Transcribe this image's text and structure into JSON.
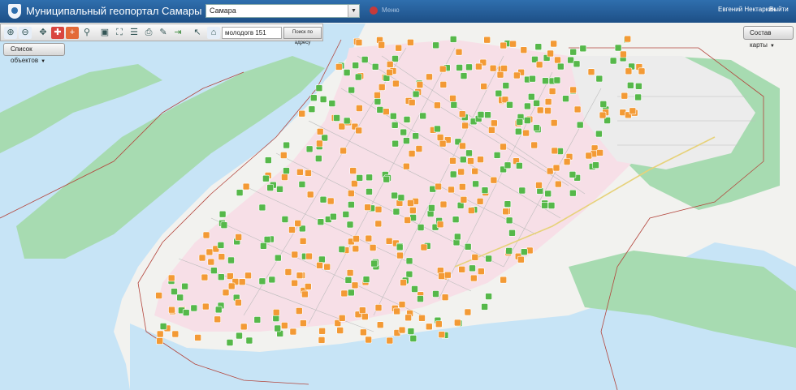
{
  "header": {
    "title": "Муниципальный геопортал Самары",
    "city": "Самара",
    "menu_label": "Меню",
    "user_name": "Евгений Нектаркин",
    "logout_label": "Выйти"
  },
  "toolbar": {
    "tools": [
      "zoom-in-icon",
      "zoom-out-icon",
      "pan-icon",
      "measure-icon",
      "add-object-icon",
      "link-icon",
      "fullscreen-icon",
      "extent-icon",
      "layers-icon",
      "print-icon",
      "edit-icon",
      "exit-icon",
      "pointer-icon",
      "address-icon"
    ],
    "search_value": "молодогв 151",
    "search_button": "Поиск по адресу"
  },
  "objects_button": "Список объектов",
  "layers_button": "Состав карты",
  "colors": {
    "header": "#1d4f86",
    "river": "#c7e4f6",
    "land": "#f2f2ef",
    "greenery": "#9fd6a8",
    "district": "#f7dfe7",
    "boundary": "#b3453c",
    "marker_orange": "#f39a35",
    "marker_green": "#56b84a"
  }
}
